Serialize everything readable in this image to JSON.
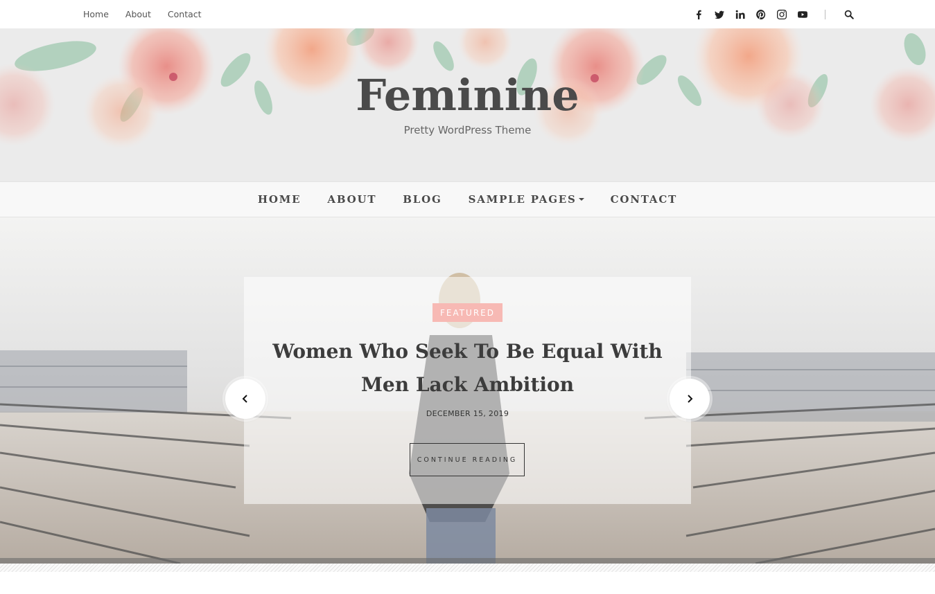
{
  "topbar": {
    "links": [
      "Home",
      "About",
      "Contact"
    ],
    "social_icons": [
      "facebook-icon",
      "twitter-icon",
      "linkedin-icon",
      "pinterest-icon",
      "instagram-icon",
      "youtube-icon"
    ],
    "search_icon": "search-icon"
  },
  "header": {
    "title": "Feminine",
    "tagline": "Pretty WordPress Theme"
  },
  "nav": {
    "items": [
      "HOME",
      "ABOUT",
      "BLOG",
      "SAMPLE PAGES",
      "CONTACT"
    ]
  },
  "slider": {
    "badge": "FEATURED",
    "title": "Women Who Seek To Be Equal With Men Lack Ambition",
    "date": "DECEMBER 15, 2019",
    "button": "CONTINUE READING",
    "prev_icon": "chevron-left-icon",
    "next_icon": "chevron-right-icon"
  },
  "colors": {
    "badge": "#f7b9b4",
    "title_text": "#4a4a4a",
    "header_bg": "#ebebeb"
  }
}
